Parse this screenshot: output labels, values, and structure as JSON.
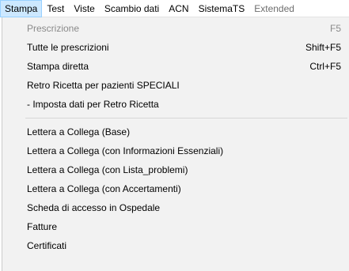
{
  "menubar": {
    "items": [
      {
        "label": "Stampa"
      },
      {
        "label": "Test"
      },
      {
        "label": "Viste"
      },
      {
        "label": "Scambio dati"
      },
      {
        "label": "ACN"
      },
      {
        "label": "SistemaTS"
      },
      {
        "label": "Extended"
      }
    ]
  },
  "dropdown": {
    "items": [
      {
        "label": "Prescrizione",
        "shortcut": "F5",
        "enabled": false
      },
      {
        "label": "Tutte le prescrizioni",
        "shortcut": "Shift+F5",
        "enabled": true
      },
      {
        "label": "Stampa diretta",
        "shortcut": "Ctrl+F5",
        "enabled": true
      },
      {
        "label": "Retro Ricetta per pazienti SPECIALI",
        "shortcut": "",
        "enabled": true
      },
      {
        "label": "- Imposta dati per Retro Ricetta",
        "shortcut": "",
        "enabled": true
      },
      {
        "label": "Lettera a Collega (Base)",
        "shortcut": "",
        "enabled": true
      },
      {
        "label": "Lettera a Collega (con Informazioni Essenziali)",
        "shortcut": "",
        "enabled": true
      },
      {
        "label": "Lettera a Collega (con Lista_problemi)",
        "shortcut": "",
        "enabled": true
      },
      {
        "label": "Lettera a Collega (con Accertamenti)",
        "shortcut": "",
        "enabled": true
      },
      {
        "label": "Scheda di accesso in Ospedale",
        "shortcut": "",
        "enabled": true
      },
      {
        "label": "Fatture",
        "shortcut": "",
        "enabled": true
      },
      {
        "label": "Certificati",
        "shortcut": "",
        "enabled": true
      }
    ]
  }
}
